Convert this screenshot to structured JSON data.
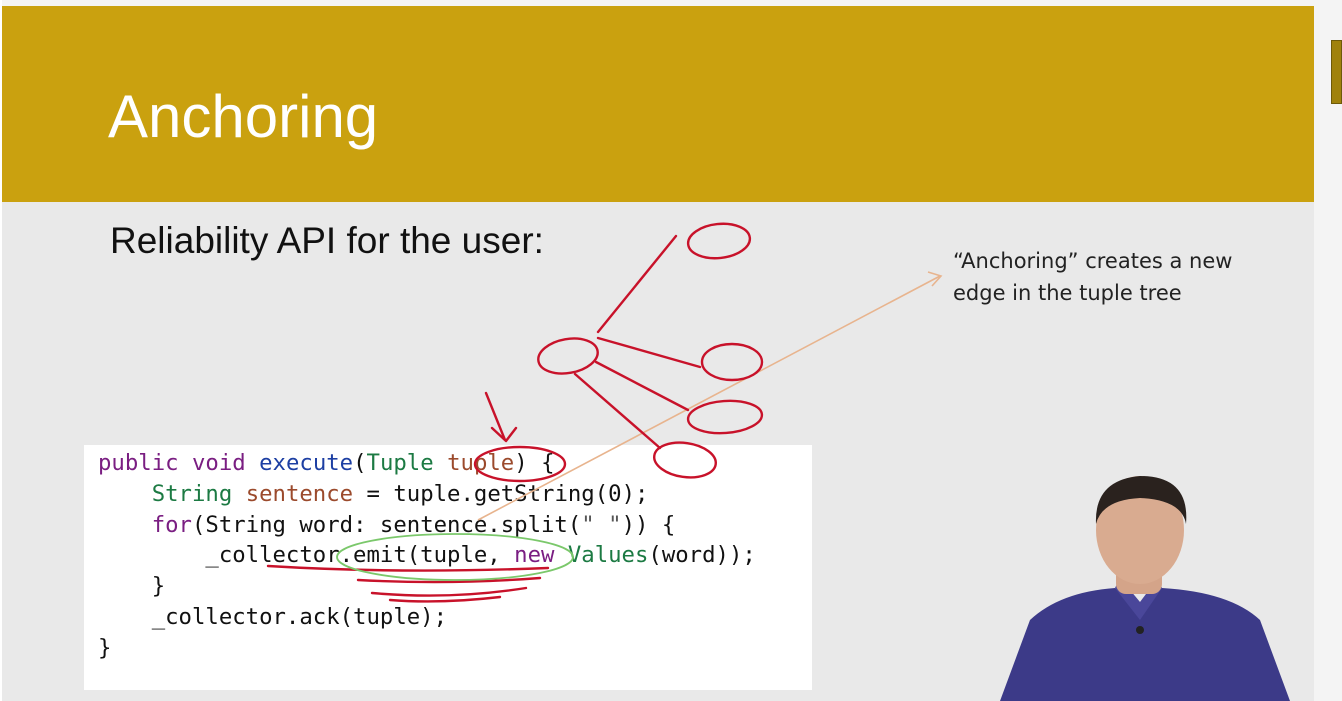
{
  "slide": {
    "title": "Anchoring",
    "subtitle": "Reliability API for the user:",
    "annotation": "“Anchoring” creates a new edge in the tuple tree"
  },
  "code": {
    "line1": {
      "t1": "public",
      "t2": " ",
      "t3": "void",
      "t4": " ",
      "t5": "execute",
      "t6": "(",
      "t7": "Tuple",
      "t8": " ",
      "t9": "tuple",
      "t10": ") {"
    },
    "line2": {
      "t1": "    ",
      "t2": "String",
      "t3": " ",
      "t4": "sentence",
      "t5": " = tuple.getString(0);"
    },
    "line3": {
      "t1": "    ",
      "t2": "for",
      "t3": "(String word: sentence.split(",
      "t4": "\" \"",
      "t5": ")) {"
    },
    "line4": {
      "t1": "        _collector.emit(tuple, ",
      "t2": "new",
      "t3": " ",
      "t4": "Values",
      "t5": "(word));"
    },
    "line5": {
      "t1": "    }"
    },
    "line6": {
      "t1": "    _collector.ack(tuple);"
    },
    "line7": {
      "t1": "}"
    }
  },
  "colors": {
    "banner": "#caa10f",
    "title_text": "#ffffff",
    "ink_red": "#c8122a",
    "ink_green": "#7bc86b",
    "arrow_peach": "#e8b48e"
  },
  "icons": [
    "presenter-figure"
  ]
}
